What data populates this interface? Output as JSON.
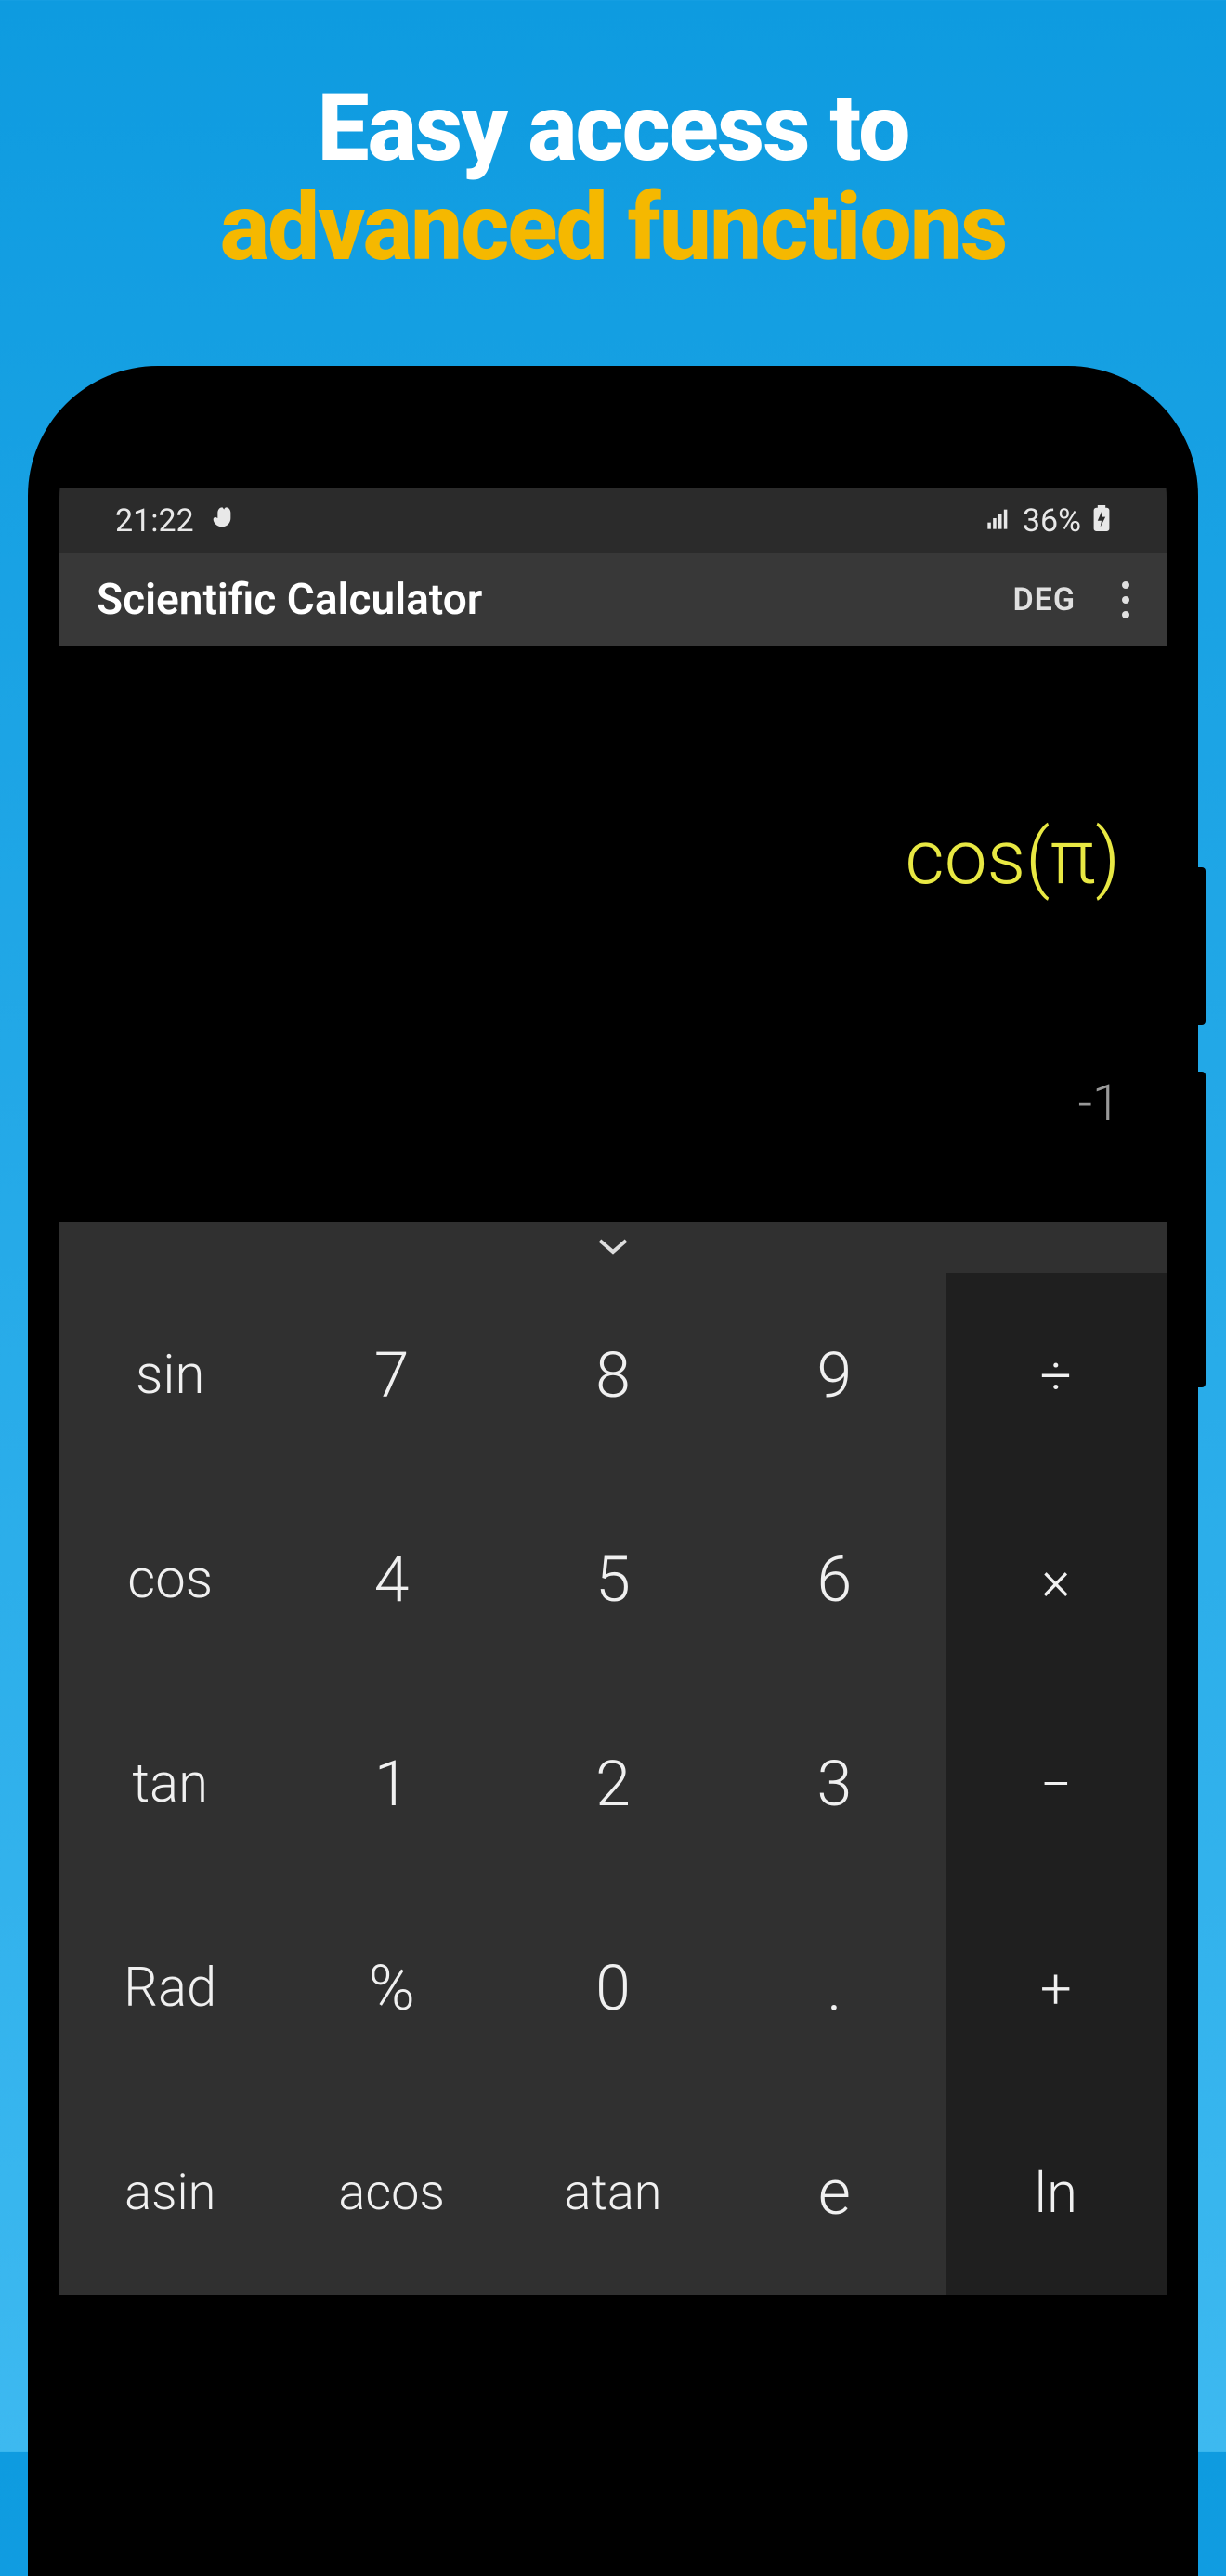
{
  "hero": {
    "line1": "Easy access to",
    "line2": "advanced functions"
  },
  "status_bar": {
    "time": "21:22",
    "battery": "36%"
  },
  "app_bar": {
    "title": "Scientific Calculator",
    "mode": "DEG"
  },
  "display": {
    "expression": "cos(π)",
    "result": "-1"
  },
  "keypad": {
    "rows": [
      [
        "sin",
        "7",
        "8",
        "9",
        "÷"
      ],
      [
        "cos",
        "4",
        "5",
        "6",
        "×"
      ],
      [
        "tan",
        "1",
        "2",
        "3",
        "−"
      ],
      [
        "Rad",
        "%",
        "0",
        ".",
        "+"
      ],
      [
        "asin",
        "acos",
        "atan",
        "e",
        "ln"
      ]
    ]
  }
}
